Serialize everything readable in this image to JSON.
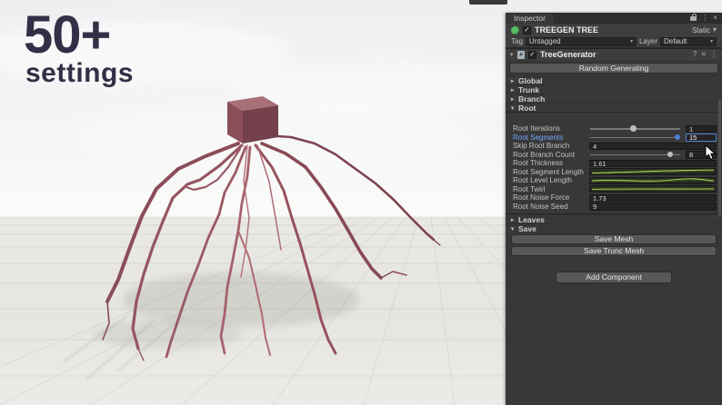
{
  "scene": {
    "headline": "50+",
    "subheadline": "settings"
  },
  "inspector": {
    "tab": "Inspector",
    "gameobject": {
      "name": "TREEGEN TREE",
      "static_label": "Static"
    },
    "tag_row": {
      "tag_label": "Tag",
      "tag_value": "Untagged",
      "layer_label": "Layer",
      "layer_value": "Default"
    },
    "component": {
      "title": "TreeGenerator",
      "random_button": "Random Generating"
    },
    "foldouts": {
      "global": "Global",
      "trunk": "Trunk",
      "branch": "Branch",
      "root": "Root",
      "leaves": "Leaves",
      "save": "Save"
    },
    "root_properties": [
      {
        "label": "Root Iterations",
        "value": "1"
      },
      {
        "label": "Root Segments",
        "value": "15"
      },
      {
        "label": "Skip Root Branch",
        "value": "4"
      },
      {
        "label": "Root Branch Count",
        "value": "8"
      },
      {
        "label": "Root Thickness",
        "value": "1.61"
      },
      {
        "label": "Root Segment Length",
        "value": ""
      },
      {
        "label": "Root Level Length",
        "value": ""
      },
      {
        "label": "Root Twirl",
        "value": ""
      },
      {
        "label": "Root Noise Force",
        "value": "1.73"
      },
      {
        "label": "Root Noise Seed",
        "value": "9"
      }
    ],
    "save_buttons": {
      "save_mesh": "Save Mesh",
      "save_trunc": "Save Trunc Mesh"
    },
    "add_component": "Add Component"
  },
  "icons": {
    "dropdown": "▾",
    "arrow_collapsed": "▸",
    "arrow_expanded": "▾",
    "check": "✓",
    "kebab": "⋮",
    "close": "×",
    "help": "?",
    "preset": "≡",
    "script": "#"
  },
  "colors": {
    "accent_blue": "#4f80d8",
    "curve_green": "#a8d14a",
    "headline_color": "#322f46",
    "panel_bg": "#383838"
  }
}
